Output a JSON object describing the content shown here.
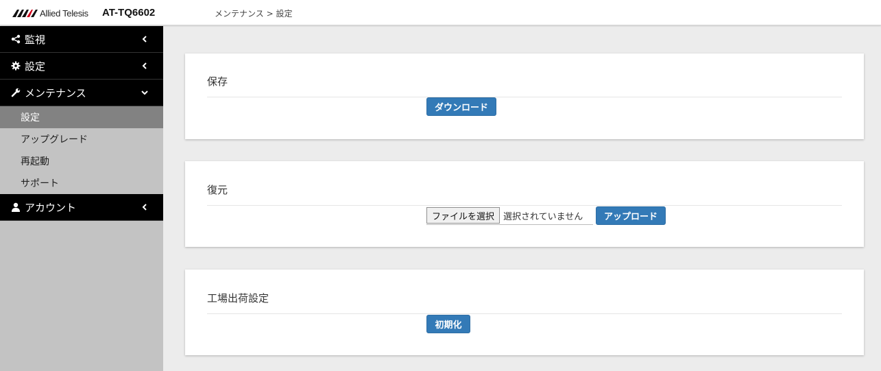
{
  "header": {
    "brand": "Allied Telesis",
    "model": "AT-TQ6602",
    "breadcrumb": "メンテナンス > 設定"
  },
  "sidebar": {
    "sections": [
      {
        "label": "監視",
        "icon": "share-icon"
      },
      {
        "label": "設定",
        "icon": "gear-icon"
      },
      {
        "label": "メンテナンス",
        "icon": "wrench-icon"
      },
      {
        "label": "アカウント",
        "icon": "user-icon"
      }
    ],
    "maintenance_items": [
      {
        "label": "設定",
        "active": true
      },
      {
        "label": "アップグレード"
      },
      {
        "label": "再起動"
      },
      {
        "label": "サポート"
      }
    ]
  },
  "main": {
    "save": {
      "title": "保存",
      "button": "ダウンロード"
    },
    "restore": {
      "title": "復元",
      "file_button": "ファイルを選択",
      "file_status": "選択されていません",
      "button": "アップロード"
    },
    "factory": {
      "title": "工場出荷設定",
      "button": "初期化"
    }
  },
  "colors": {
    "primary": "#337ab7",
    "nav_bg": "#000000",
    "sidebar_bg": "#c3c3c3",
    "active_item": "#828282"
  }
}
